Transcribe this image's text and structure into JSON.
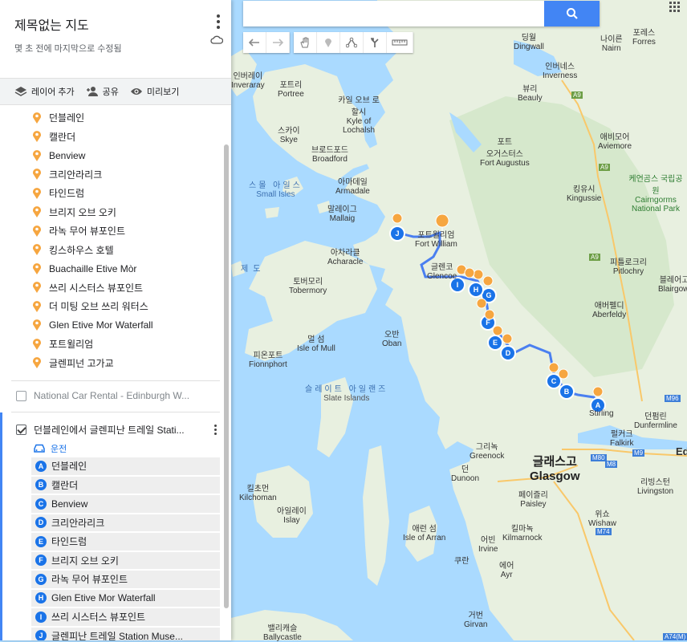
{
  "panel": {
    "title": "제목없는 지도",
    "subtitle": "몇 초 전에 마지막으로 수정됨",
    "toolbar": [
      {
        "icon": "layers-icon",
        "label": "레이어 추가"
      },
      {
        "icon": "add-person-icon",
        "label": "공유"
      },
      {
        "icon": "eye-icon",
        "label": "미리보기"
      }
    ],
    "places": [
      "던블레인",
      "캘란더",
      "Benview",
      "크리안라리크",
      "타인드럼",
      "브리지 오브 오키",
      "라녹 무어 뷰포인트",
      "킹스하우스 호텔",
      "Buachaille Etive Mòr",
      "쓰리 시스터스 뷰포인트",
      "더 미팅 오브 쓰리 워터스",
      "Glen Etive Mor Waterfall",
      "포트윌리엄",
      "글렌피넌 고가교"
    ],
    "layer2": {
      "label": "National Car Rental - Edinburgh W...",
      "checked": false
    },
    "layer3": {
      "label": "던블레인에서 글렌피난 트레일 Stati...",
      "checked": true,
      "mode": "운전",
      "stops": [
        {
          "letter": "A",
          "label": "던블레인"
        },
        {
          "letter": "B",
          "label": "캘란더"
        },
        {
          "letter": "C",
          "label": "Benview"
        },
        {
          "letter": "D",
          "label": "크리안라리크"
        },
        {
          "letter": "E",
          "label": "타인드럼"
        },
        {
          "letter": "F",
          "label": "브리지 오브 오키"
        },
        {
          "letter": "G",
          "label": "라녹 무어 뷰포인트"
        },
        {
          "letter": "H",
          "label": "Glen Etive Mor Waterfall"
        },
        {
          "letter": "I",
          "label": "쓰리 시스터스 뷰포인트"
        },
        {
          "letter": "J",
          "label": "글렌피난 트레일 Station Muse..."
        }
      ]
    }
  },
  "map": {
    "search": {
      "placeholder": ""
    },
    "tools": [
      "undo-icon",
      "redo-icon",
      "hand-icon",
      "marker-icon",
      "line-icon",
      "directions-icon",
      "ruler-icon"
    ],
    "labels": [
      {
        "ko": "딩월",
        "en": "Dingwall"
      },
      {
        "ko": "나이른",
        "en": "Nairn"
      },
      {
        "ko": "포레스",
        "en": "Forres"
      },
      {
        "ko": "인버네스",
        "en": "Inverness"
      },
      {
        "ko": "뷰리",
        "en": "Beauly"
      },
      {
        "ko": "포트리",
        "en": "Portree"
      },
      {
        "ko": "카일 오브 로할시",
        "en": "Kyle of Lochalsh"
      },
      {
        "ko": "스카이",
        "en": "Skye"
      },
      {
        "ko": "브로드포드",
        "en": "Broadford"
      },
      {
        "ko": "포트",
        "en": "오거스터스"
      },
      {
        "ko": "",
        "en": "Fort Augustus"
      },
      {
        "ko": "애비모어",
        "en": "Aviemore"
      },
      {
        "ko": "킹유시",
        "en": "Kingussie"
      },
      {
        "ko": "케언곰스 국립공원",
        "en": "Cairngorms National Park"
      },
      {
        "ko": "스몰 아일스",
        "en": "Small Isles"
      },
      {
        "ko": "아마데일",
        "en": "Armadale"
      },
      {
        "ko": "말레이그",
        "en": "Mallaig"
      },
      {
        "ko": "포트윌리엄",
        "en": "Fort William"
      },
      {
        "ko": "아차라클",
        "en": "Acharacle"
      },
      {
        "ko": "글렌코",
        "en": "Glencoe"
      },
      {
        "ko": "피틀로크리",
        "en": "Pitlochry"
      },
      {
        "ko": "토버모리",
        "en": "Tobermory"
      },
      {
        "ko": "제도",
        "en": ""
      },
      {
        "ko": "애버펠디",
        "en": "Aberfeldy"
      },
      {
        "ko": "블레어고리",
        "en": "Blairgowrie"
      },
      {
        "ko": "멀 섬",
        "en": "Isle of Mull"
      },
      {
        "ko": "오반",
        "en": "Oban"
      },
      {
        "ko": "피온포트",
        "en": "Fionnphort"
      },
      {
        "ko": "슬레이트 아일랜즈",
        "en": "Slate Islands"
      },
      {
        "ko": "스털링",
        "en": "Stirling"
      },
      {
        "ko": "던펌린",
        "en": "Dunfermline"
      },
      {
        "ko": "펄커크",
        "en": "Falkirk"
      },
      {
        "ko": "그리녹",
        "en": "Greenock"
      },
      {
        "ko": "글래스고",
        "en": "Glasgow"
      },
      {
        "ko": "던",
        "en": "Dunoon"
      },
      {
        "ko": "킬초먼",
        "en": "Kilchoman"
      },
      {
        "ko": "아일레이",
        "en": "Islay"
      },
      {
        "ko": "페이즐리",
        "en": "Paisley"
      },
      {
        "ko": "리빙스턴",
        "en": "Livingston"
      },
      {
        "ko": "위쇼",
        "en": "Wishaw"
      },
      {
        "ko": "킬마녹",
        "en": "Kilmarnock"
      },
      {
        "ko": "어빈",
        "en": "Irvine"
      },
      {
        "ko": "애런 섬",
        "en": "Isle of Arran"
      },
      {
        "ko": "에어",
        "en": "Ayr"
      },
      {
        "ko": "거번",
        "en": "Girvan"
      },
      {
        "ko": "밸리캐슬",
        "en": "Ballycastle"
      },
      {
        "ko": "인버레이",
        "en": "Inveraray"
      },
      {
        "ko": "쿠란",
        "en": "Curran"
      }
    ],
    "roads": [
      "A9",
      "A9",
      "A9",
      "M9",
      "M80",
      "M8",
      "M74",
      "M96",
      "A74(M)"
    ],
    "edge_labels": [
      "Ed",
      "Ed",
      "Pe"
    ]
  }
}
